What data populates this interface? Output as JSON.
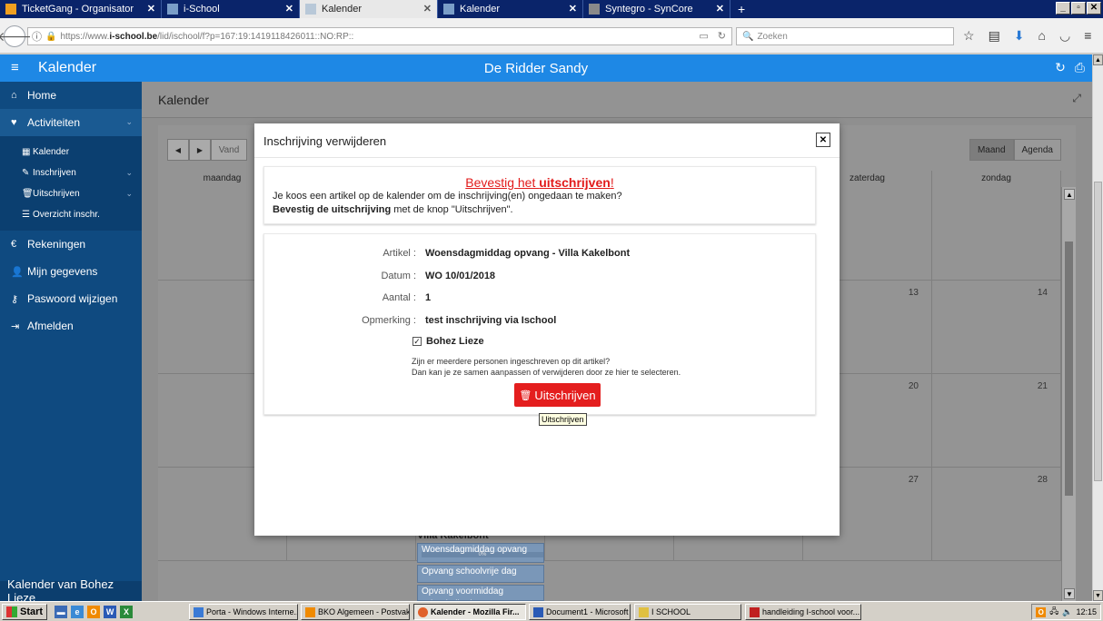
{
  "browser": {
    "tabs": [
      {
        "label": "TicketGang - Organisator",
        "color": "#f0a020"
      },
      {
        "label": "i-School",
        "color": "#7a9ec8"
      },
      {
        "label": "Kalender",
        "color": "#b8c8d8"
      },
      {
        "label": "Kalender",
        "color": "#7a9ec8"
      },
      {
        "label": "Syntegro - SynCore",
        "color": "#8a8a8a"
      }
    ],
    "url_prefix": "https://www.",
    "url_domain": "i-school.be",
    "url_rest": "/lid/ischool/f?p=167:19:1419118426011::NO:RP::",
    "search_placeholder": "Zoeken"
  },
  "app": {
    "title": "Kalender",
    "user": "De Ridder Sandy"
  },
  "sidebar": {
    "items": [
      {
        "icon": "home-icon",
        "label": "Home"
      },
      {
        "icon": "heart-pulse-icon",
        "label": "Activiteiten"
      },
      {
        "icon": "euro-icon",
        "label": "Rekeningen"
      },
      {
        "icon": "user-icon",
        "label": "Mijn gegevens"
      },
      {
        "icon": "key-icon",
        "label": "Paswoord wijzigen"
      },
      {
        "icon": "logout-icon",
        "label": "Afmelden"
      }
    ],
    "subitems": [
      {
        "icon": "calendar-icon",
        "label": "Kalender"
      },
      {
        "icon": "edit-icon",
        "label": "Inschrijven"
      },
      {
        "icon": "trash-icon",
        "label": "Uitschrijven"
      },
      {
        "icon": "list-icon",
        "label": "Overzicht inschr."
      }
    ],
    "footer": "Kalender van Bohez Lieze"
  },
  "main": {
    "title": "Kalender",
    "nav_today": "Vand",
    "view_month": "Maand",
    "view_agenda": "Agenda",
    "days": [
      "maandag",
      "",
      "",
      "",
      "",
      "zaterdag",
      "zondag"
    ],
    "day_numbers": {
      "r1": [
        "13",
        "14"
      ],
      "r2": [
        "20",
        "21"
      ],
      "r3": [
        "27",
        "28"
      ]
    },
    "event_title": "Villa Kakelbont",
    "events": [
      "Woensdagmiddag opvang",
      "Opvang schoolvrije dag",
      "Opvang voormiddag schoolvrije dag"
    ],
    "event_progress": "0%"
  },
  "modal": {
    "title": "Inschrijving verwijderen",
    "confirm_pre": "Bevestig het ",
    "confirm_bold": "uitschrijven",
    "confirm_post": "!",
    "line1": "Je koos een artikel op de kalender om de inschrijving(en) ongedaan te maken?",
    "line2_bold": "Bevestig de uitschrijving",
    "line2_rest": " met de knop \"Uitschrijven\".",
    "fields": [
      {
        "label": "Artikel :",
        "value": "Woensdagmiddag opvang - Villa Kakelbont"
      },
      {
        "label": "Datum :",
        "value": "WO 10/01/2018"
      },
      {
        "label": "Aantal :",
        "value": "1"
      },
      {
        "label": "Opmerking :",
        "value": "test inschrijving via Ischool"
      }
    ],
    "checkbox_label": "Bohez Lieze",
    "checkbox_checked": true,
    "question1": "Zijn er meerdere personen ingeschreven op dit artikel?",
    "question2": "Dan kan je ze samen aanpassen of verwijderen door ze hier te selecteren.",
    "button": "Uitschrijven",
    "tooltip": "Uitschrijven"
  },
  "taskbar": {
    "start": "Start",
    "tasks": [
      {
        "label": "Porta - Windows Interne...",
        "color": "#3a7ad5"
      },
      {
        "label": "BKO Algemeen - Postvak...",
        "color": "#f08a00"
      },
      {
        "label": "Kalender - Mozilla Fir...",
        "color": "#e0602a"
      },
      {
        "label": "Document1 - Microsoft ...",
        "color": "#2a5ab5"
      },
      {
        "label": "I SCHOOL",
        "color": "#e0c040"
      },
      {
        "label": "handleiding I-school voor...",
        "color": "#c02020"
      }
    ],
    "clock": "12:15"
  }
}
